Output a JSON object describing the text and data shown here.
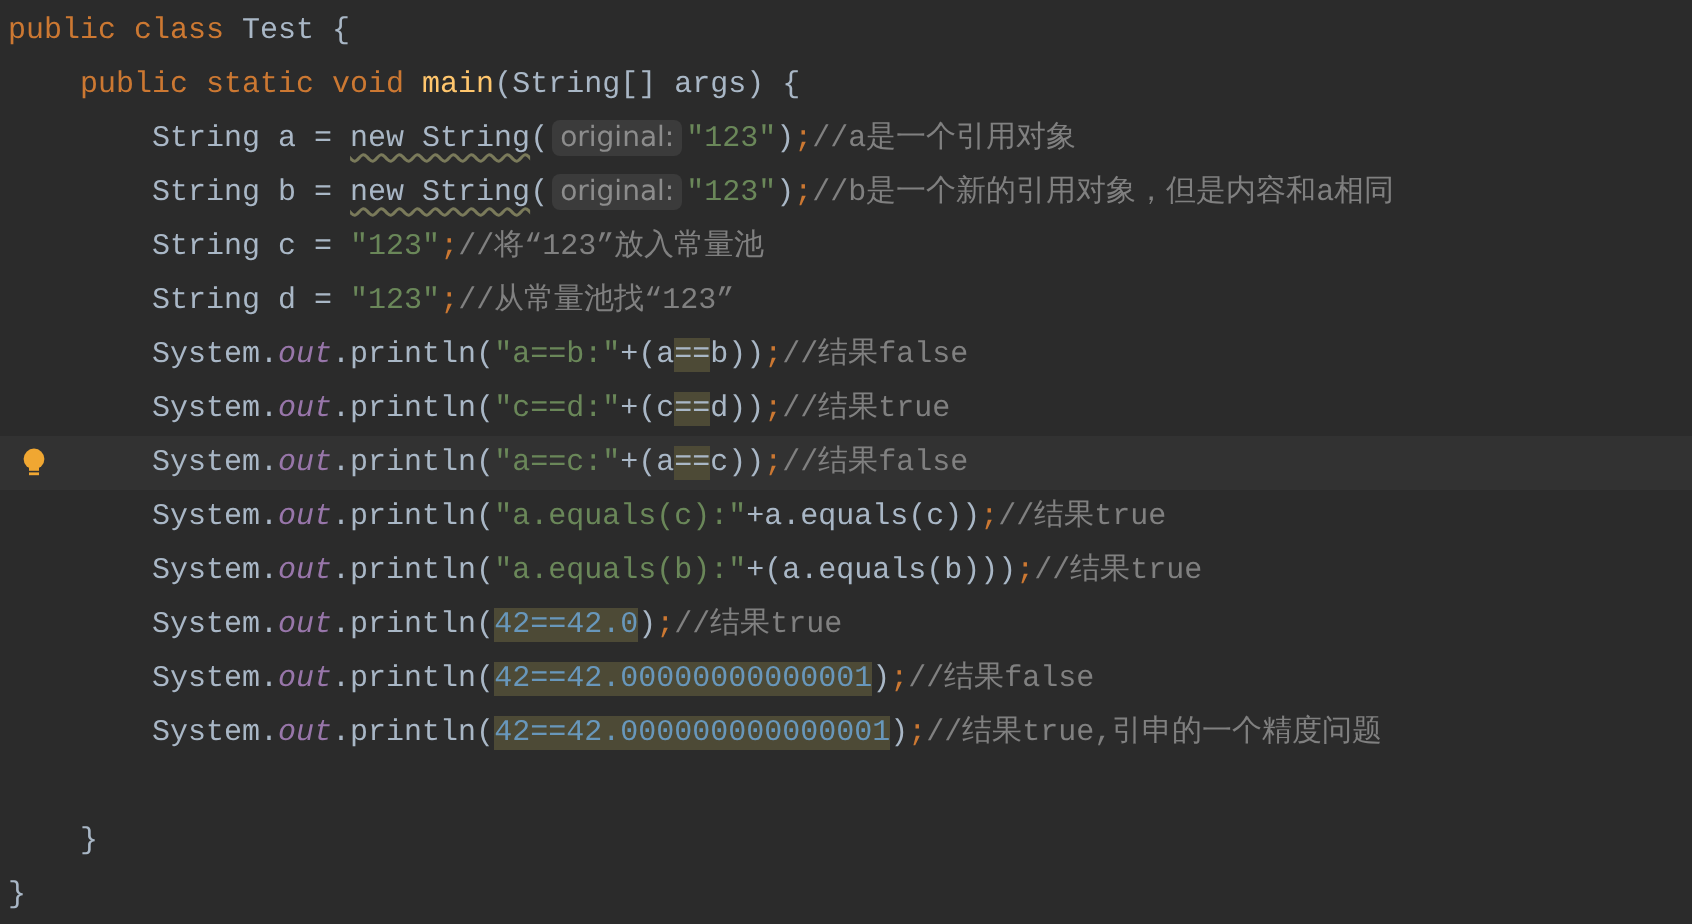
{
  "editor": {
    "lines": [
      {
        "current": false,
        "tokens": [
          {
            "kind": "keyword",
            "text": "public class "
          },
          {
            "kind": "plain",
            "text": "Test {"
          }
        ]
      },
      {
        "current": false,
        "tokens": [
          {
            "kind": "keyword",
            "text": "    public static void "
          },
          {
            "kind": "method",
            "text": "main"
          },
          {
            "kind": "plain",
            "text": "(String[] args) {"
          }
        ]
      },
      {
        "current": false,
        "tokens": [
          {
            "kind": "plain",
            "text": "        String a = "
          },
          {
            "kind": "warning",
            "text": "new String"
          },
          {
            "kind": "plain",
            "text": "("
          },
          {
            "kind": "hint",
            "text": "original:"
          },
          {
            "kind": "string",
            "text": "\"123\""
          },
          {
            "kind": "plain",
            "text": ")"
          },
          {
            "kind": "keyword",
            "text": ";"
          },
          {
            "kind": "comment",
            "text": "//a是一个引用对象"
          }
        ]
      },
      {
        "current": false,
        "tokens": [
          {
            "kind": "plain",
            "text": "        String b = "
          },
          {
            "kind": "warning",
            "text": "new String"
          },
          {
            "kind": "plain",
            "text": "("
          },
          {
            "kind": "hint",
            "text": "original:"
          },
          {
            "kind": "string",
            "text": "\"123\""
          },
          {
            "kind": "plain",
            "text": ")"
          },
          {
            "kind": "keyword",
            "text": ";"
          },
          {
            "kind": "comment",
            "text": "//b是一个新的引用对象，但是内容和a相同"
          }
        ]
      },
      {
        "current": false,
        "tokens": [
          {
            "kind": "plain",
            "text": "        String c = "
          },
          {
            "kind": "string",
            "text": "\"123\""
          },
          {
            "kind": "keyword",
            "text": ";"
          },
          {
            "kind": "comment",
            "text": "//将“123”放入常量池"
          }
        ]
      },
      {
        "current": false,
        "tokens": [
          {
            "kind": "plain",
            "text": "        String d = "
          },
          {
            "kind": "string",
            "text": "\"123\""
          },
          {
            "kind": "keyword",
            "text": ";"
          },
          {
            "kind": "comment",
            "text": "//从常量池找“123”"
          }
        ]
      },
      {
        "current": false,
        "tokens": [
          {
            "kind": "plain",
            "text": "        System."
          },
          {
            "kind": "field",
            "text": "out"
          },
          {
            "kind": "plain",
            "text": ".println("
          },
          {
            "kind": "string",
            "text": "\"a==b:\""
          },
          {
            "kind": "plain",
            "text": "+(a"
          },
          {
            "kind": "match",
            "text": "=="
          },
          {
            "kind": "plain",
            "text": "b))"
          },
          {
            "kind": "keyword",
            "text": ";"
          },
          {
            "kind": "comment",
            "text": "//结果false"
          }
        ]
      },
      {
        "current": false,
        "tokens": [
          {
            "kind": "plain",
            "text": "        System."
          },
          {
            "kind": "field",
            "text": "out"
          },
          {
            "kind": "plain",
            "text": ".println("
          },
          {
            "kind": "string",
            "text": "\"c==d:\""
          },
          {
            "kind": "plain",
            "text": "+(c"
          },
          {
            "kind": "match",
            "text": "=="
          },
          {
            "kind": "plain",
            "text": "d))"
          },
          {
            "kind": "keyword",
            "text": ";"
          },
          {
            "kind": "comment",
            "text": "//结果true"
          }
        ]
      },
      {
        "current": true,
        "tokens": [
          {
            "kind": "plain",
            "text": "        System."
          },
          {
            "kind": "field",
            "text": "out"
          },
          {
            "kind": "plain",
            "text": ".println("
          },
          {
            "kind": "string",
            "text": "\"a==c:\""
          },
          {
            "kind": "plain",
            "text": "+(a"
          },
          {
            "kind": "match",
            "text": "=="
          },
          {
            "kind": "plain",
            "text": "c))"
          },
          {
            "kind": "keyword",
            "text": ";"
          },
          {
            "kind": "comment",
            "text": "//结果false"
          }
        ]
      },
      {
        "current": false,
        "tokens": [
          {
            "kind": "plain",
            "text": "        System."
          },
          {
            "kind": "field",
            "text": "out"
          },
          {
            "kind": "plain",
            "text": ".println("
          },
          {
            "kind": "string",
            "text": "\"a.equals(c):\""
          },
          {
            "kind": "plain",
            "text": "+a.equals(c))"
          },
          {
            "kind": "keyword",
            "text": ";"
          },
          {
            "kind": "comment",
            "text": "//结果true"
          }
        ]
      },
      {
        "current": false,
        "tokens": [
          {
            "kind": "plain",
            "text": "        System."
          },
          {
            "kind": "field",
            "text": "out"
          },
          {
            "kind": "plain",
            "text": ".println("
          },
          {
            "kind": "string",
            "text": "\"a.equals(b):\""
          },
          {
            "kind": "plain",
            "text": "+(a.equals(b)))"
          },
          {
            "kind": "keyword",
            "text": ";"
          },
          {
            "kind": "comment",
            "text": "//结果true"
          }
        ]
      },
      {
        "current": false,
        "tokens": [
          {
            "kind": "plain",
            "text": "        System."
          },
          {
            "kind": "field",
            "text": "out"
          },
          {
            "kind": "plain",
            "text": ".println("
          },
          {
            "kind": "number-match",
            "text": "42==42.0"
          },
          {
            "kind": "plain",
            "text": ")"
          },
          {
            "kind": "keyword",
            "text": ";"
          },
          {
            "kind": "comment",
            "text": "//结果true"
          }
        ]
      },
      {
        "current": false,
        "tokens": [
          {
            "kind": "plain",
            "text": "        System."
          },
          {
            "kind": "field",
            "text": "out"
          },
          {
            "kind": "plain",
            "text": ".println("
          },
          {
            "kind": "number-match",
            "text": "42==42.00000000000001"
          },
          {
            "kind": "plain",
            "text": ")"
          },
          {
            "kind": "keyword",
            "text": ";"
          },
          {
            "kind": "comment",
            "text": "//结果false"
          }
        ]
      },
      {
        "current": false,
        "tokens": [
          {
            "kind": "plain",
            "text": "        System."
          },
          {
            "kind": "field",
            "text": "out"
          },
          {
            "kind": "plain",
            "text": ".println("
          },
          {
            "kind": "number-match",
            "text": "42==42.000000000000001"
          },
          {
            "kind": "plain",
            "text": ")"
          },
          {
            "kind": "keyword",
            "text": ";"
          },
          {
            "kind": "comment",
            "text": "//结果true,引申的一个精度问题"
          }
        ]
      },
      {
        "current": false
      },
      {
        "current": false,
        "tokens": [
          {
            "kind": "plain",
            "text": "    }"
          }
        ]
      },
      {
        "current": false,
        "tokens": [
          {
            "kind": "plain",
            "text": "}"
          }
        ]
      }
    ]
  }
}
